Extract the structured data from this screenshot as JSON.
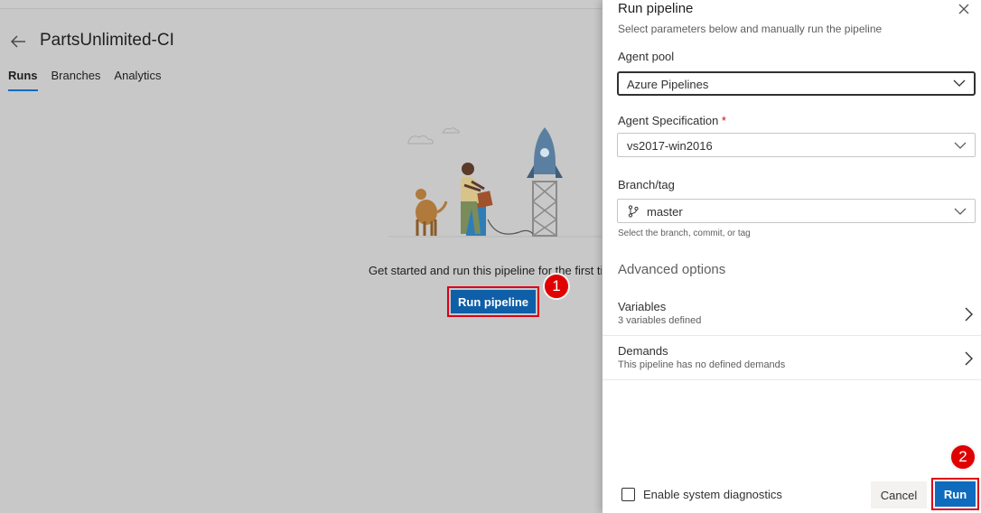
{
  "page": {
    "title": "PartsUnlimited-CI",
    "tabs": [
      "Runs",
      "Branches",
      "Analytics"
    ],
    "active_tab": "Runs",
    "empty_message": "Get started and run this pipeline for the first time",
    "run_pipeline_label": "Run pipeline"
  },
  "panel": {
    "title": "Run pipeline",
    "subtitle": "Select parameters below and manually run the pipeline",
    "agent_pool": {
      "label": "Agent pool",
      "value": "Azure Pipelines"
    },
    "agent_spec": {
      "label": "Agent Specification",
      "required_mark": "*",
      "value": "vs2017-win2016"
    },
    "branch": {
      "label": "Branch/tag",
      "value": "master",
      "hint": "Select the branch, commit, or tag"
    },
    "advanced_title": "Advanced options",
    "variables": {
      "title": "Variables",
      "subtitle": "3 variables defined"
    },
    "demands": {
      "title": "Demands",
      "subtitle": "This pipeline has no defined demands"
    },
    "diagnostics_label": "Enable system diagnostics",
    "diagnostics_checked": false,
    "cancel_label": "Cancel",
    "run_label": "Run"
  },
  "annotations": {
    "step1": "1",
    "step2": "2"
  },
  "icons": {
    "back": "back-arrow-icon",
    "close": "close-icon",
    "chevron_down": "chevron-down-icon",
    "chevron_right": "chevron-right-icon",
    "branch": "branch-icon",
    "illustration": "rocket-launch-illustration"
  },
  "colors": {
    "primary": "#0f6cbd",
    "annotation_red": "#e00000",
    "overlay_gray": "#c8c8c8",
    "required": "#c50f1f"
  }
}
